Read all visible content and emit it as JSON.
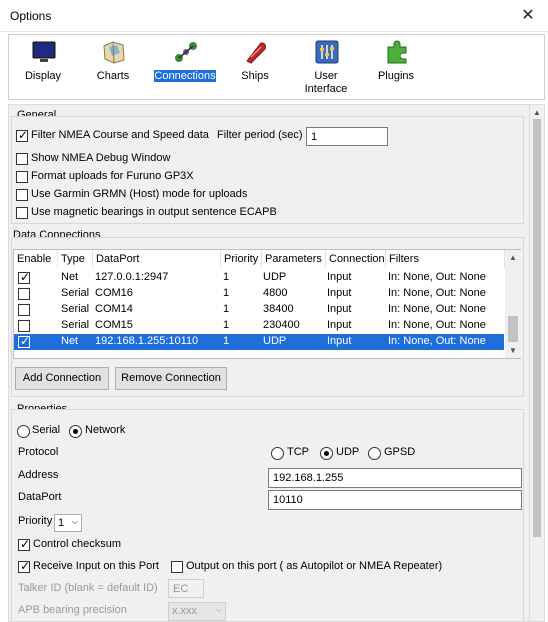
{
  "window": {
    "title": "Options",
    "close_glyph": "✕"
  },
  "toolbar": {
    "items": [
      {
        "label": "Display",
        "icon": "display-icon"
      },
      {
        "label": "Charts",
        "icon": "charts-icon"
      },
      {
        "label": "Connections",
        "icon": "connections-icon",
        "selected": true
      },
      {
        "label": "Ships",
        "icon": "ships-icon"
      },
      {
        "label": "User\nInterface",
        "label_line1": "User",
        "label_line2": "Interface",
        "icon": "user-interface-icon"
      },
      {
        "label": "Plugins",
        "icon": "plugins-icon"
      }
    ]
  },
  "general": {
    "title": "General",
    "filter_nmea": "Filter NMEA Course and Speed data",
    "filter_period_label": "Filter period (sec)",
    "filter_period_value": "1",
    "show_debug": "Show NMEA Debug Window",
    "furuno": "Format uploads for Furuno GP3X",
    "garmin": "Use Garmin GRMN (Host) mode for uploads",
    "magnetic": "Use magnetic bearings in output sentence ECAPB"
  },
  "data_connections": {
    "title": "Data Connections",
    "columns": [
      "Enable",
      "Type",
      "DataPort",
      "Priority",
      "Parameters",
      "Connection",
      "Filters"
    ],
    "rows": [
      {
        "enabled": true,
        "type": "Net",
        "dataport": "127.0.0.1:2947",
        "priority": "1",
        "parameters": "UDP",
        "connection": "Input",
        "filters": "In: None, Out: None"
      },
      {
        "enabled": false,
        "type": "Serial",
        "dataport": "COM16",
        "priority": "1",
        "parameters": "4800",
        "connection": "Input",
        "filters": "In: None, Out: None"
      },
      {
        "enabled": false,
        "type": "Serial",
        "dataport": "COM14",
        "priority": "1",
        "parameters": "38400",
        "connection": "Input",
        "filters": "In: None, Out: None"
      },
      {
        "enabled": false,
        "type": "Serial",
        "dataport": "COM15",
        "priority": "1",
        "parameters": "230400",
        "connection": "Input",
        "filters": "In: None, Out: None"
      },
      {
        "enabled": true,
        "type": "Net",
        "dataport": "192.168.1.255:10110",
        "priority": "1",
        "parameters": "UDP",
        "connection": "Input",
        "filters": "In: None, Out: None",
        "selected": true
      }
    ],
    "add_button": "Add Connection",
    "remove_button": "Remove Connection"
  },
  "properties": {
    "title": "Properties",
    "serial_label": "Serial",
    "network_label": "Network",
    "protocol_label": "Protocol",
    "tcp_label": "TCP",
    "udp_label": "UDP",
    "gpsd_label": "GPSD",
    "address_label": "Address",
    "address_value": "192.168.1.255",
    "dataport_label": "DataPort",
    "dataport_value": "10110",
    "priority_label": "Priority",
    "priority_value": "1",
    "control_checksum": "Control checksum",
    "receive_input": "Receive Input on this Port",
    "output_port": "Output on this port ( as Autopilot or NMEA Repeater)",
    "talker_label": "Talker ID (blank = default ID)",
    "talker_value": "EC",
    "apb_label": "APB bearing precision",
    "apb_value": "x.xxx"
  },
  "colors": {
    "selection": "#1e6fd9",
    "panel": "#f0f0f0"
  }
}
